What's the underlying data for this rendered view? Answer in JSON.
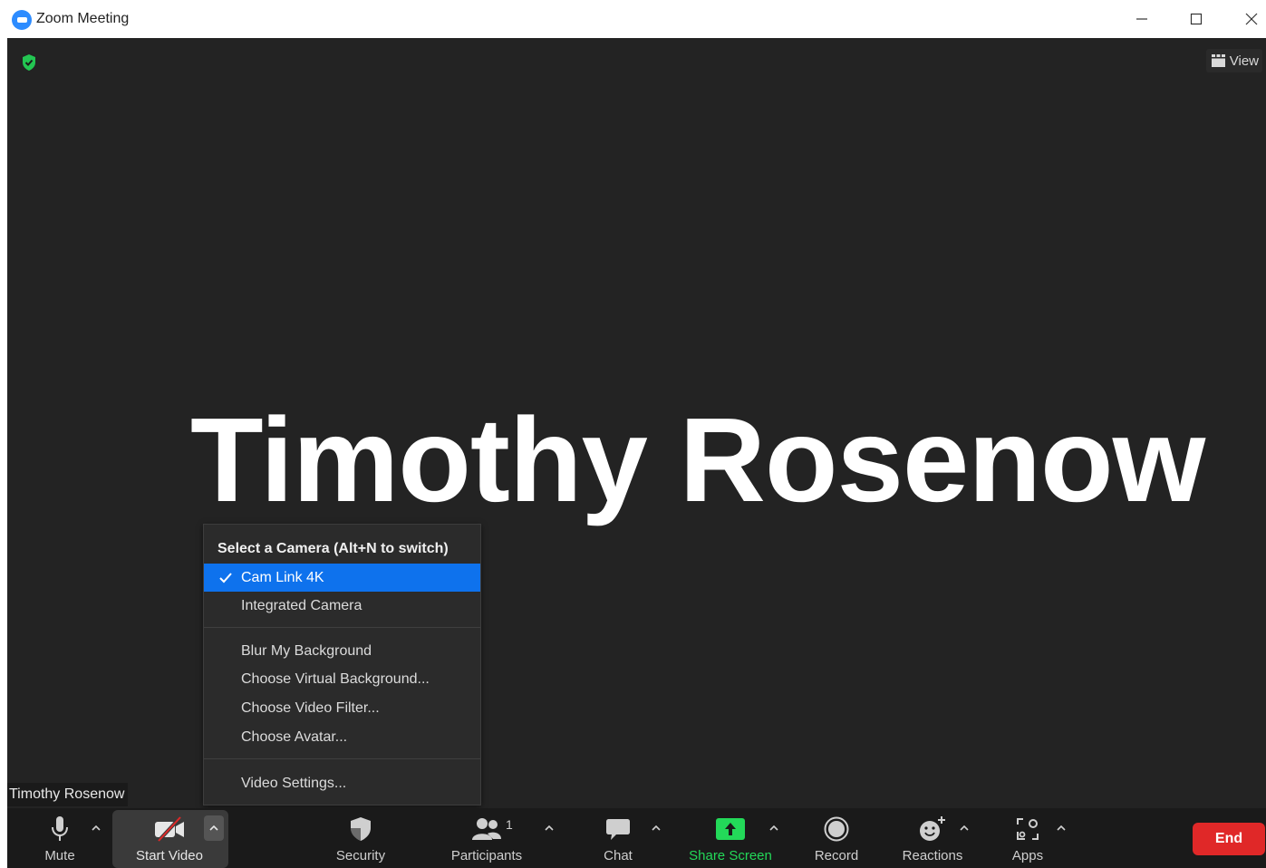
{
  "window": {
    "title": "Zoom Meeting"
  },
  "meeting": {
    "participant_display_name": "Timothy Rosenow",
    "name_tag": "Timothy Rosenow",
    "view_label": "View",
    "encryption_icon": "shield-check-icon"
  },
  "camera_menu": {
    "header": "Select a Camera (Alt+N to switch)",
    "cameras": [
      {
        "label": "Cam Link 4K",
        "selected": true
      },
      {
        "label": "Integrated Camera",
        "selected": false
      }
    ],
    "background_items": [
      {
        "label": "Blur My Background"
      },
      {
        "label": "Choose Virtual Background..."
      },
      {
        "label": "Choose Video Filter..."
      },
      {
        "label": "Choose Avatar..."
      }
    ],
    "settings_item": {
      "label": "Video Settings..."
    }
  },
  "toolbar": {
    "mute_label": "Mute",
    "video_label": "Start Video",
    "security_label": "Security",
    "participants_label": "Participants",
    "participants_count": "1",
    "chat_label": "Chat",
    "share_label": "Share Screen",
    "record_label": "Record",
    "reactions_label": "Reactions",
    "apps_label": "Apps",
    "end_label": "End"
  },
  "colors": {
    "meeting_bg": "#232323",
    "toolbar_bg": "#1a1a1a",
    "menu_selected": "#0e72ed",
    "share_green": "#23d959",
    "end_red": "#e02828",
    "zoom_blue": "#2d8cff"
  }
}
